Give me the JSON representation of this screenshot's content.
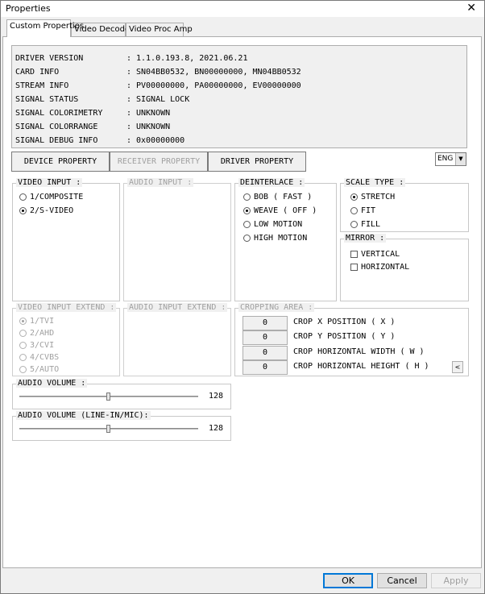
{
  "window": {
    "title": "Properties",
    "close_glyph": "✕"
  },
  "tabs": [
    {
      "label": "Custom Properties"
    },
    {
      "label": "Video Decoder"
    },
    {
      "label": "Video Proc Amp"
    }
  ],
  "info": [
    {
      "label": "DRIVER VERSION",
      "value": "1.1.0.193.8, 2021.06.21"
    },
    {
      "label": "CARD INFO",
      "value": "SN04BB0532, BN00000000, MN04BB0532"
    },
    {
      "label": "STREAM INFO",
      "value": "PV00000000, PA00000000, EV00000000"
    },
    {
      "label": "SIGNAL STATUS",
      "value": "SIGNAL LOCK"
    },
    {
      "label": "SIGNAL COLORIMETRY",
      "value": "UNKNOWN"
    },
    {
      "label": "SIGNAL COLORRANGE",
      "value": "UNKNOWN"
    },
    {
      "label": "SIGNAL DEBUG INFO",
      "value": "0x00000000"
    }
  ],
  "colon": ":",
  "property_buttons": {
    "device": "DEVICE PROPERTY",
    "receiver": "RECEIVER PROPERTY",
    "driver": "DRIVER PROPERTY"
  },
  "language": {
    "selected": "ENG",
    "arrow": "▼"
  },
  "video_input": {
    "title": "VIDEO INPUT :",
    "options": [
      {
        "label": "1/COMPOSITE",
        "selected": false
      },
      {
        "label": "2/S-VIDEO",
        "selected": true
      }
    ]
  },
  "audio_input": {
    "title": "AUDIO INPUT :"
  },
  "deinterlace": {
    "title": "DEINTERLACE :",
    "options": [
      {
        "label": "BOB ( FAST )",
        "selected": false
      },
      {
        "label": "WEAVE ( OFF )",
        "selected": true
      },
      {
        "label": "LOW MOTION",
        "selected": false
      },
      {
        "label": "HIGH MOTION",
        "selected": false
      }
    ]
  },
  "scale_type": {
    "title": "SCALE TYPE :",
    "options": [
      {
        "label": "STRETCH",
        "selected": true
      },
      {
        "label": "FIT",
        "selected": false
      },
      {
        "label": "FILL",
        "selected": false
      }
    ]
  },
  "mirror": {
    "title": "MIRROR :",
    "options": [
      {
        "label": "VERTICAL",
        "checked": false
      },
      {
        "label": "HORIZONTAL",
        "checked": false
      }
    ]
  },
  "video_input_extend": {
    "title": "VIDEO INPUT EXTEND :",
    "options": [
      {
        "label": "1/TVI",
        "selected": true
      },
      {
        "label": "2/AHD",
        "selected": false
      },
      {
        "label": "3/CVI",
        "selected": false
      },
      {
        "label": "4/CVBS",
        "selected": false
      },
      {
        "label": "5/AUTO",
        "selected": false
      }
    ]
  },
  "audio_input_extend": {
    "title": "AUDIO INPUT EXTEND :"
  },
  "cropping": {
    "title": "CROPPING AREA :",
    "rows": [
      {
        "value": "0",
        "label": "CROP X POSITION ( X )"
      },
      {
        "value": "0",
        "label": "CROP Y POSITION ( Y )"
      },
      {
        "value": "0",
        "label": "CROP HORIZONTAL WIDTH ( W )"
      },
      {
        "value": "0",
        "label": "CROP HORIZONTAL HEIGHT ( H )"
      }
    ],
    "scroll_glyph": "<"
  },
  "audio_volume": {
    "title": "AUDIO VOLUME :",
    "value": "128",
    "level": 0.5
  },
  "audio_volume_line": {
    "title": "AUDIO VOLUME (LINE-IN/MIC):",
    "value": "128",
    "level": 0.5
  },
  "dialog_buttons": {
    "ok": "OK",
    "cancel": "Cancel",
    "apply": "Apply"
  }
}
